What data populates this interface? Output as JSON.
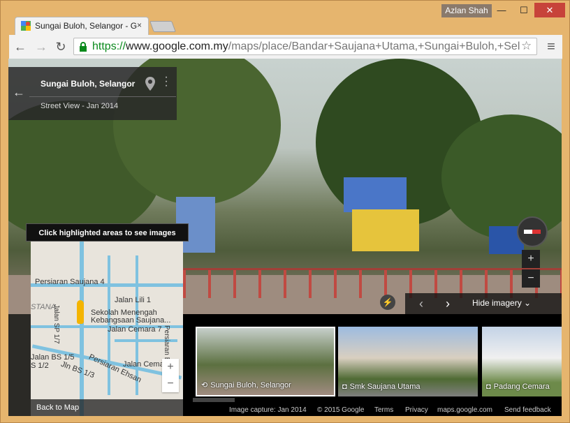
{
  "window": {
    "user": "Azlan Shah",
    "minimize": "—",
    "maximize": "☐",
    "close": "✕"
  },
  "tab": {
    "title": "Sungai Buloh, Selangor - G",
    "close": "×"
  },
  "toolbar": {
    "back": "←",
    "forward": "→",
    "reload": "↻",
    "url_scheme": "https://",
    "url_host": "www.google.com.my",
    "url_path": "/maps/place/Bandar+Saujana+Utama,+Sungai+Buloh,+Sel",
    "menu": "≡"
  },
  "card": {
    "title": "Sungai Buloh, Selangor",
    "subtitle": "Street View - Jan 2014",
    "back": "←"
  },
  "minimap": {
    "hint": "Click highlighted areas to see images",
    "labels": [
      "Persiaran Saujana 4",
      "STANA",
      "Jalan Lili 1",
      "Jalan SP 1/7",
      "Sekolah Menengah",
      "Kebangsaan Saujana...",
      "Jalan Cemara 7",
      "Jalan BS 1/5",
      "S 1/2",
      "Jln BS 1/3",
      "Persiaran Ehsan",
      "Jalan Cemar",
      "Persiaran Ehsan"
    ],
    "zoom_in": "+",
    "zoom_out": "−",
    "back_to_map": "Back to Map"
  },
  "controls": {
    "zoom_in": "+",
    "zoom_out": "−",
    "prev": "‹",
    "next": "›",
    "hide_imagery": "Hide imagery",
    "hide_icon": "⌄"
  },
  "thumbs": [
    {
      "label": "Sungai Buloh, Selangor",
      "icon": "360-icon"
    },
    {
      "label": "Smk Saujana Utama",
      "icon": "camera-icon"
    },
    {
      "label": "Padang Cemara",
      "icon": "camera-icon"
    }
  ],
  "footer": {
    "capture": "Image capture: Jan 2014",
    "copyright": "© 2015 Google",
    "terms": "Terms",
    "privacy": "Privacy",
    "domain": "maps.google.com",
    "feedback": "Send feedback"
  }
}
